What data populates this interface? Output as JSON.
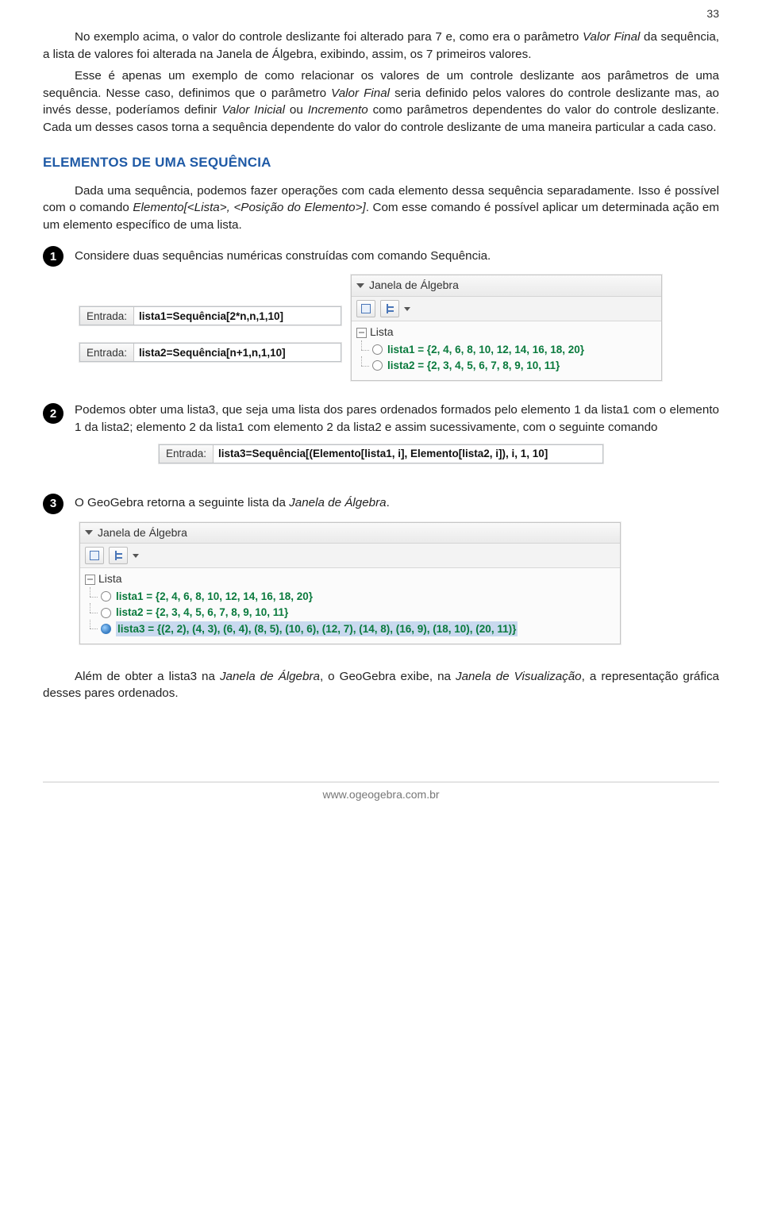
{
  "pageNumber": "33",
  "para1_a": "No exemplo acima, o valor do controle deslizante foi alterado para 7 e, como era o parâmetro ",
  "para1_vf": "Valor Final",
  "para1_b": " da sequência, a lista de valores foi alterada na Janela de Álgebra, exibindo, assim, os 7 primeiros valores.",
  "para2_a": "Esse é apenas um exemplo de como relacionar os valores de um controle deslizante aos parâmetros de uma sequência. Nesse caso, definimos que o parâmetro ",
  "para2_vf": "Valor Final",
  "para2_b": " seria definido pelos valores do controle deslizante mas, ao invés desse, poderíamos definir ",
  "para2_vi": "Valor Inicial",
  "para2_c": " ou ",
  "para2_inc": "Incremento",
  "para2_d": " como parâmetros dependentes do valor do controle deslizante. Cada um desses casos torna a sequência dependente do valor do controle deslizante de uma maneira particular a cada caso.",
  "heading": "ELEMENTOS DE UMA SEQUÊNCIA",
  "para3_a": "Dada uma sequência, podemos fazer operações com cada elemento dessa sequência separadamente. Isso é possível com o comando ",
  "para3_cmd": "Elemento[<Lista>, <Posição do Elemento>]",
  "para3_b": ". Com esse comando é possível aplicar um determinada ação em um elemento específico de uma lista.",
  "step1": "Considere duas sequências numéricas construídas com comando Sequência.",
  "input_label": "Entrada:",
  "input1_value": "lista1=Sequência[2*n,n,1,10]",
  "input2_value": "lista2=Sequência[n+1,n,1,10]",
  "panel_title": "Janela de Álgebra",
  "tree_root": "Lista",
  "tree1_item1": "lista1 = {2, 4, 6, 8, 10, 12, 14, 16, 18, 20}",
  "tree1_item2": "lista2 = {2, 3, 4, 5, 6, 7, 8, 9, 10, 11}",
  "step2": "Podemos obter uma lista3, que seja uma lista dos pares ordenados formados pelo elemento 1 da lista1 com o elemento 1 da lista2; elemento 2 da lista1 com elemento 2 da lista2 e assim sucessivamente, com o seguinte comando",
  "input3_value": "lista3=Sequência[(Elemento[lista1, i], Elemento[lista2, i]), i, 1, 10]",
  "step3_a": "O GeoGebra retorna a seguinte lista da ",
  "step3_ja": "Janela de Álgebra",
  "step3_b": ".",
  "tree2_item1": "lista1 = {2, 4, 6, 8, 10, 12, 14, 16, 18, 20}",
  "tree2_item2": "lista2 = {2, 3, 4, 5, 6, 7, 8, 9, 10, 11}",
  "tree2_item3": "lista3 = {(2, 2), (4, 3), (6, 4), (8, 5), (10, 6), (12, 7), (14, 8), (16, 9), (18, 10), (20, 11)}",
  "para4_a": "Além de obter a lista3 na ",
  "para4_ja": "Janela de Álgebra",
  "para4_b": ", o GeoGebra exibe, na ",
  "para4_jv": "Janela de Visualização",
  "para4_c": ", a representação gráfica desses pares ordenados.",
  "footer": "www.ogeogebra.com.br",
  "badge1": "1",
  "badge2": "2",
  "badge3": "3"
}
